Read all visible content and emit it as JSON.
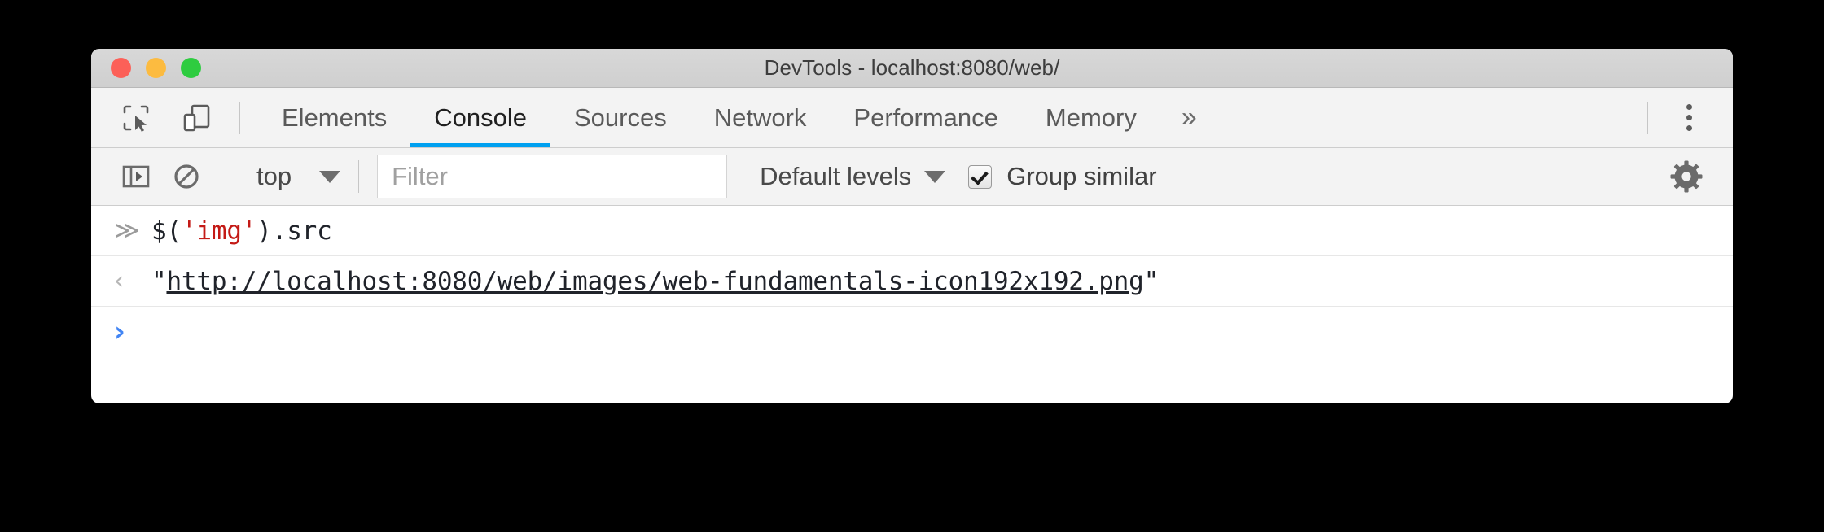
{
  "window": {
    "title": "DevTools - localhost:8080/web/",
    "traffic_lights": [
      {
        "name": "close",
        "color": "#fc6058"
      },
      {
        "name": "minimize",
        "color": "#fcbb40"
      },
      {
        "name": "zoom",
        "color": "#2ecc40"
      }
    ]
  },
  "tabbar": {
    "icons": [
      {
        "name": "inspect-element-icon",
        "title": "Inspect element"
      },
      {
        "name": "device-toolbar-icon",
        "title": "Toggle device toolbar"
      }
    ],
    "tabs": [
      {
        "label": "Elements",
        "active": false
      },
      {
        "label": "Console",
        "active": true
      },
      {
        "label": "Sources",
        "active": false
      },
      {
        "label": "Network",
        "active": false
      },
      {
        "label": "Performance",
        "active": false
      },
      {
        "label": "Memory",
        "active": false
      }
    ],
    "more_tabs_label": "»",
    "menu_icon": "kebab-menu-icon",
    "active_underline_color": "#00a0f0"
  },
  "console_toolbar": {
    "sidebar_toggle_icon": "console-sidebar-icon",
    "clear_console_icon": "clear-console-icon",
    "context": {
      "label": "top",
      "caret": "▼"
    },
    "filter": {
      "value": "",
      "placeholder": "Filter"
    },
    "levels": {
      "label": "Default levels",
      "caret": "▼"
    },
    "group_similar": {
      "label": "Group similar",
      "checked": true
    },
    "settings_icon": "gear-icon"
  },
  "console": {
    "rows": [
      {
        "type": "input",
        "marker": "≫",
        "tokens": [
          {
            "text": "$(",
            "kind": "plain"
          },
          {
            "text": "'img'",
            "kind": "string"
          },
          {
            "text": ").src",
            "kind": "plain"
          }
        ]
      },
      {
        "type": "output",
        "marker": "‹",
        "tokens": [
          {
            "text": "\"",
            "kind": "plain"
          },
          {
            "text": "http://localhost:8080/web/images/web-fundamentals-icon192x192.png",
            "kind": "link"
          },
          {
            "text": "\"",
            "kind": "plain"
          }
        ]
      }
    ],
    "prompt": {
      "caret": "›",
      "value": "",
      "caret_color": "#4285f4"
    }
  }
}
